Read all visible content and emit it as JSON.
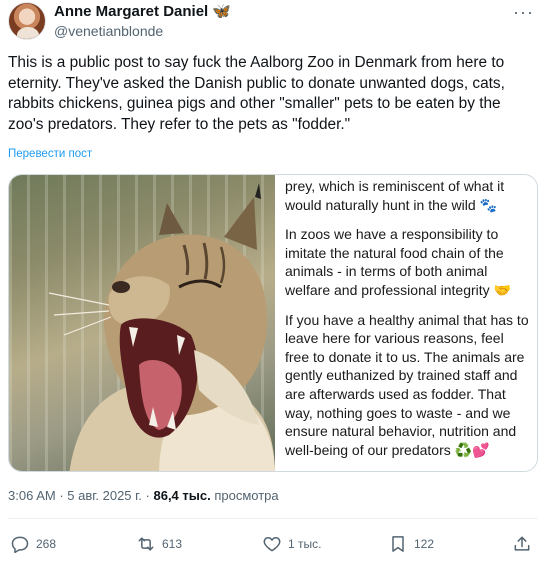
{
  "author": {
    "display_name": "Anne Margaret Daniel",
    "emoji": "🦋",
    "handle": "@venetianblonde"
  },
  "more_label": "···",
  "tweet": {
    "text": "This is a public post to say fuck the Aalborg Zoo in Denmark from here to eternity. They've asked the Danish public to donate unwanted dogs, cats, rabbits chickens, guinea pigs and other \"smaller\" pets to be eaten by the zoo's predators. They refer to the pets as \"fodder.\"",
    "translate_label": "Перевести пост"
  },
  "media": {
    "paragraphs": [
      "prey, which is reminiscent of what it would naturally hunt in the wild 🐾",
      "In zoos we have a responsibility to imitate the natural food chain of the animals - in terms of both animal welfare and professional integrity 🤝",
      "If you have a healthy animal that has to leave here for various reasons, feel free to donate it to us. The animals are gently euthanized by trained staff and are afterwards used as fodder. That way, nothing goes to waste - and we ensure natural behavior, nutrition and well-being of our predators ♻️💕"
    ]
  },
  "meta": {
    "time": "3:06 AM",
    "sep1": " · ",
    "date": "5 авг. 2025 г.",
    "sep2": " · ",
    "views_count": "86,4 тыс.",
    "views_label": " просмотра"
  },
  "actions": {
    "replies": "268",
    "reposts": "613",
    "likes": "1 тыс.",
    "bookmarks": "122"
  },
  "colors": {
    "accent": "#1d9bf0",
    "secondary_text": "#536471",
    "primary_text": "#0f1419"
  }
}
